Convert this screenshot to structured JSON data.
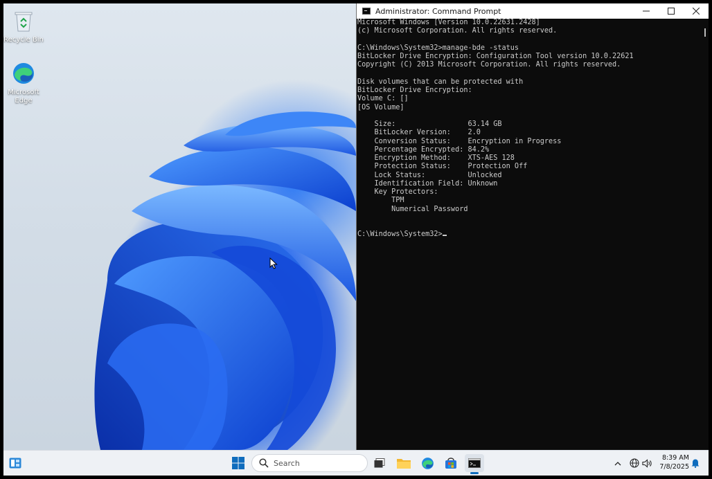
{
  "desktop": {
    "icons": [
      {
        "label": "Recycle Bin"
      },
      {
        "label": "Microsoft Edge"
      }
    ]
  },
  "console": {
    "title": "Administrator: Command Prompt",
    "lines": [
      "Microsoft Windows [Version 10.0.22631.2428]",
      "(c) Microsoft Corporation. All rights reserved.",
      "",
      "C:\\Windows\\System32>manage-bde -status",
      "BitLocker Drive Encryption: Configuration Tool version 10.0.22621",
      "Copyright (C) 2013 Microsoft Corporation. All rights reserved.",
      "",
      "Disk volumes that can be protected with",
      "BitLocker Drive Encryption:",
      "Volume C: []",
      "[OS Volume]",
      "",
      "    Size:                 63.14 GB",
      "    BitLocker Version:    2.0",
      "    Conversion Status:    Encryption in Progress",
      "    Percentage Encrypted: 84.2%",
      "    Encryption Method:    XTS-AES 128",
      "    Protection Status:    Protection Off",
      "    Lock Status:          Unlocked",
      "    Identification Field: Unknown",
      "    Key Protectors:",
      "        TPM",
      "        Numerical Password",
      "",
      ""
    ],
    "prompt": "C:\\Windows\\System32>"
  },
  "taskbar": {
    "search_placeholder": "Search",
    "time": "8:39 AM",
    "date": "7/8/2025"
  },
  "colors": {
    "console_bg": "#0c0c0c",
    "console_text": "#cccccc",
    "taskbar_bg": "#eef1f5",
    "accent": "#0f6cbd"
  }
}
